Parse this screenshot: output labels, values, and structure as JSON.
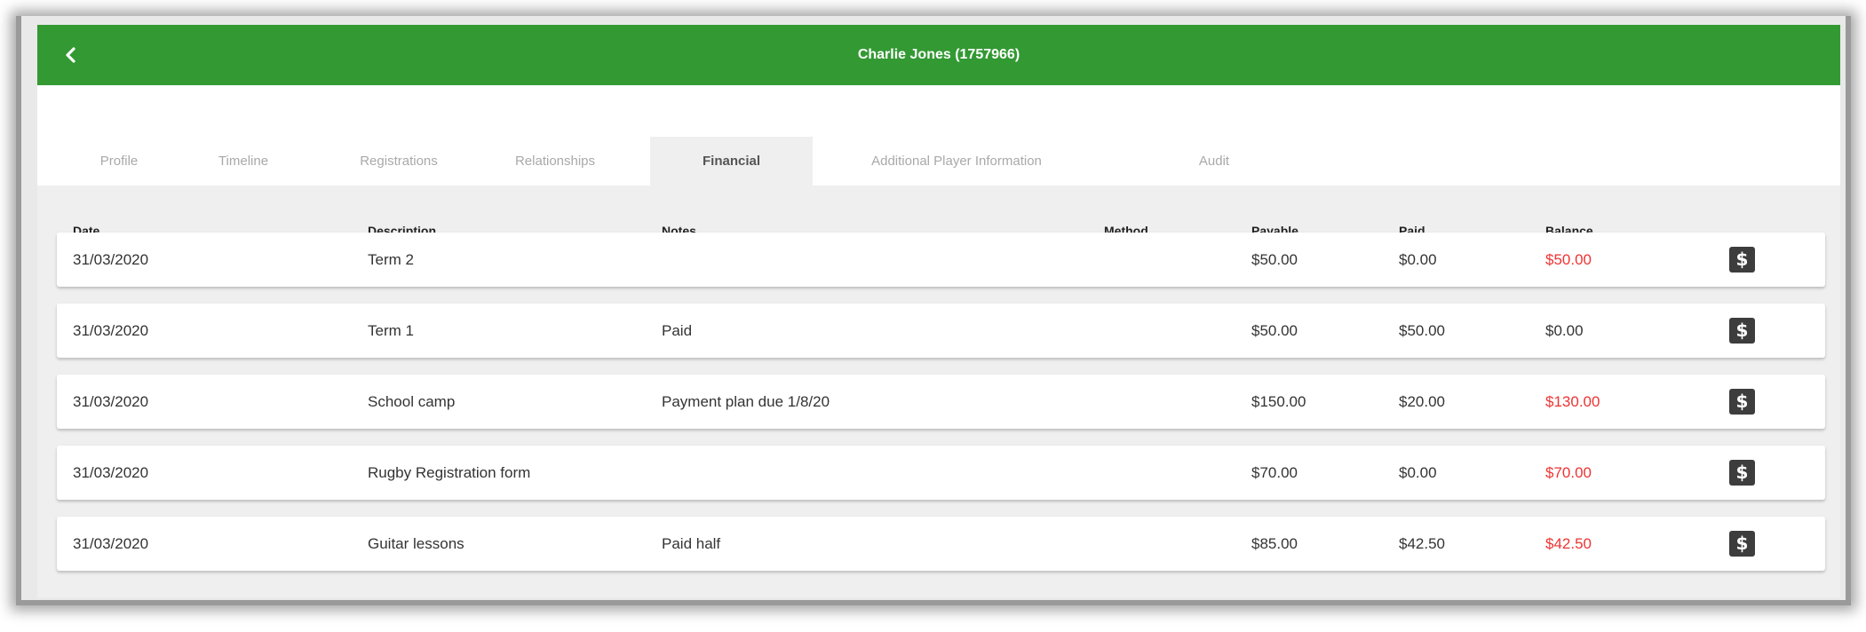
{
  "header": {
    "title": "Charlie Jones (1757966)",
    "back_icon": "chevron-left-icon",
    "color": "#339933"
  },
  "tabs": [
    {
      "label": "Profile",
      "active": false
    },
    {
      "label": "Timeline",
      "active": false
    },
    {
      "label": "Registrations",
      "active": false
    },
    {
      "label": "Relationships",
      "active": false
    },
    {
      "label": "Financial",
      "active": true
    },
    {
      "label": "Additional Player Information",
      "active": false
    },
    {
      "label": "Audit",
      "active": false
    }
  ],
  "table": {
    "columns": {
      "date": "Date",
      "description": "Description",
      "notes": "Notes",
      "method": "Method",
      "payable": "Payable",
      "paid": "Paid",
      "balance": "Balance"
    },
    "rows": [
      {
        "date": "31/03/2020",
        "description": "Term 2",
        "notes": "",
        "method": "",
        "payable": "$50.00",
        "paid": "$0.00",
        "balance": "$50.00",
        "outstanding": true
      },
      {
        "date": "31/03/2020",
        "description": "Term 1",
        "notes": "Paid",
        "method": "",
        "payable": "$50.00",
        "paid": "$50.00",
        "balance": "$0.00",
        "outstanding": false
      },
      {
        "date": "31/03/2020",
        "description": "School camp",
        "notes": "Payment plan due 1/8/20",
        "method": "",
        "payable": "$150.00",
        "paid": "$20.00",
        "balance": "$130.00",
        "outstanding": true
      },
      {
        "date": "31/03/2020",
        "description": "Rugby Registration form",
        "notes": "",
        "method": "",
        "payable": "$70.00",
        "paid": "$0.00",
        "balance": "$70.00",
        "outstanding": true
      },
      {
        "date": "31/03/2020",
        "description": "Guitar lessons",
        "notes": "Paid half",
        "method": "",
        "payable": "$85.00",
        "paid": "$42.50",
        "balance": "$42.50",
        "outstanding": true
      }
    ],
    "row_action_icon": "dollar-icon",
    "outstanding_color": "#ee3333"
  }
}
